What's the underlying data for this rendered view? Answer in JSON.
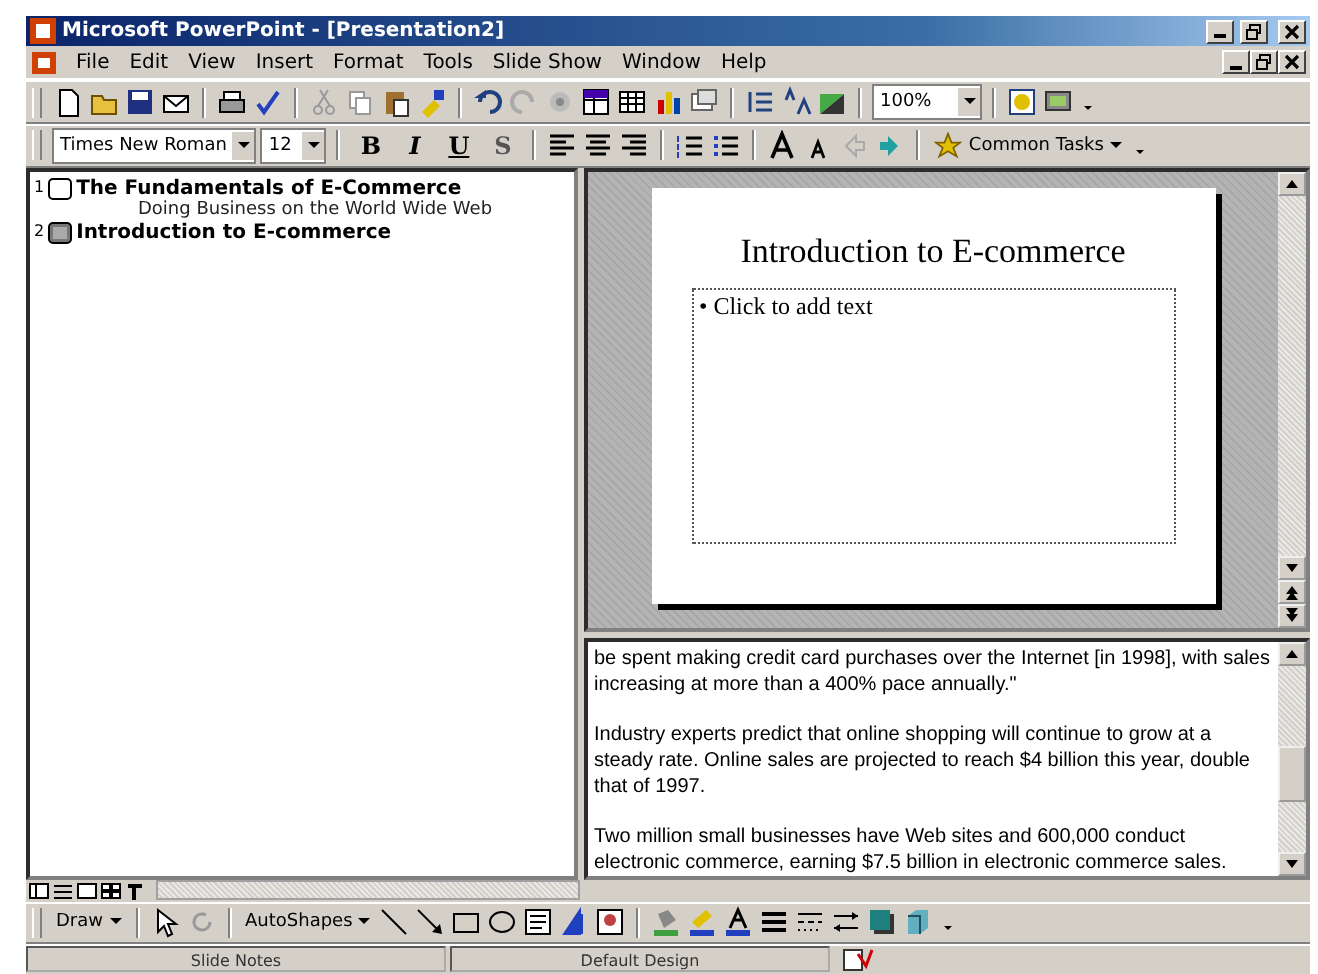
{
  "window": {
    "title": "Microsoft PowerPoint - [Presentation2]"
  },
  "menu": [
    "File",
    "Edit",
    "View",
    "Insert",
    "Format",
    "Tools",
    "Slide Show",
    "Window",
    "Help"
  ],
  "standard_toolbar": {
    "zoom": "100%"
  },
  "formatting_toolbar": {
    "font": "Times New Roman",
    "size": "12",
    "styles": [
      "B",
      "I",
      "U",
      "S"
    ],
    "common_tasks": "Common Tasks"
  },
  "outline": [
    {
      "number": "1",
      "title": "The Fundamentals of E-Commerce",
      "selected": false,
      "children": [
        "Doing Business on the World Wide Web"
      ]
    },
    {
      "number": "2",
      "title": "Introduction to E-commerce",
      "selected": true
    }
  ],
  "slide": {
    "title": "Introduction to E-commerce",
    "body_placeholder": "• Click to add text"
  },
  "notes": [
    "be spent making credit card purchases over the Internet [in 1998], with sales increasing at more than a 400% pace annually.\"",
    "Industry experts predict that online shopping will continue to grow at a steady rate. Online sales are projected to reach $4 billion this year, double that of 1997.",
    "Two million small businesses have Web sites and 600,000 conduct electronic commerce, earning $7.5 billion in electronic commerce sales."
  ],
  "drawing_toolbar": {
    "draw": "Draw",
    "autoshapes": "AutoShapes"
  },
  "status_bar": [
    "Slide Notes",
    "Default Design"
  ]
}
